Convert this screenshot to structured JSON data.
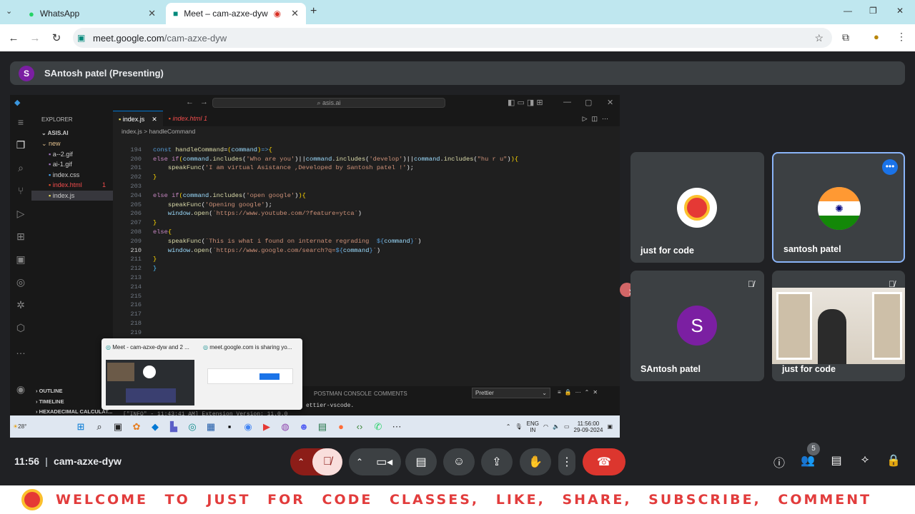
{
  "browser": {
    "tabs": [
      {
        "label": "WhatsApp",
        "icon": "whatsapp-icon"
      },
      {
        "label": "Meet – cam-azxe-dyw",
        "icon": "meet-icon"
      }
    ],
    "url_host": "meet.google.com",
    "url_path": "/cam-azxe-dyw"
  },
  "presenting": {
    "avatar_letter": "S",
    "label": "SAntosh patel (Presenting)"
  },
  "vscode": {
    "search_text": "asis.ai",
    "explorer_title": "EXPLORER",
    "project": "ASIS.AI",
    "tree": [
      {
        "name": "new",
        "type": "folder"
      },
      {
        "name": "a--2.gif",
        "type": "gif"
      },
      {
        "name": "ai-1.gif",
        "type": "gif"
      },
      {
        "name": "index.css",
        "type": "css"
      },
      {
        "name": "index.html",
        "type": "html",
        "badge": "1"
      },
      {
        "name": "index.js",
        "type": "js"
      }
    ],
    "sections": [
      "OUTLINE",
      "TIMELINE",
      "HEXADECIMAL CALCULAT..."
    ],
    "editor_tabs": [
      "index.js",
      "index.html 1"
    ],
    "breadcrumb": "index.js > handleCommand",
    "panel_tabs": [
      "POSTMAN CONSOLE",
      "COMMENTS"
    ],
    "panel_select": "Prettier",
    "panel_text": "ettier-vscode.",
    "panel_log": "[\"INFO\" - 11:43:41 AM] Extension Version: 11.0.0",
    "taskbar_weather": "28°",
    "taskbar_lang": "ENG",
    "taskbar_lang2": "IN",
    "taskbar_time": "11:56:00",
    "taskbar_date": "29-09-2024"
  },
  "thumbnail": {
    "left_title": "Meet - cam-azxe-dyw and 2 ...",
    "right_title": "meet.google.com is sharing yo..."
  },
  "participants": [
    {
      "name": "just for code",
      "avatar": "jfc-logo"
    },
    {
      "name": "santosh patel",
      "avatar": "india-flag"
    },
    {
      "name": "SAntosh patel",
      "avatar": "S"
    },
    {
      "name": "just for code",
      "avatar": "camera-video"
    }
  ],
  "meeting": {
    "time": "11:56",
    "code": "cam-azxe-dyw",
    "people_count": "5"
  },
  "banner": {
    "text": "WELCOME TO JUST FOR CODE CLASSES, LIKE, SHARE, SUBSCRIBE, COMMENT"
  }
}
